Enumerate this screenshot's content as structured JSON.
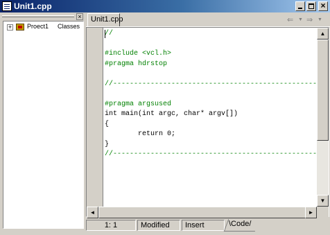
{
  "window": {
    "title": "Unit1.cpp",
    "controls": {
      "minimize": "_",
      "maximize": "□",
      "close": "×"
    }
  },
  "class_explorer": {
    "close_glyph": "×",
    "tree": [
      {
        "expander": "+",
        "label": "Proect1",
        "secondary": "Classes"
      }
    ]
  },
  "tabs": [
    {
      "label": "Unit1.cpp",
      "active": true
    }
  ],
  "navigation": {
    "back": "⇐",
    "forward": "⇒",
    "dropdown": "▼"
  },
  "editor": {
    "lines": [
      {
        "text": "//",
        "kind": "comment"
      },
      {
        "text": "",
        "kind": "blank"
      },
      {
        "text": "#include <vcl.h>",
        "kind": "directive"
      },
      {
        "text": "#pragma hdrstop",
        "kind": "directive"
      },
      {
        "text": "",
        "kind": "blank"
      },
      {
        "text": "//---------------------------------------------------------------------------",
        "kind": "comment"
      },
      {
        "text": "",
        "kind": "blank"
      },
      {
        "text": "#pragma argsused",
        "kind": "directive"
      },
      {
        "text": "int main(int argc, char* argv[])",
        "kind": "code"
      },
      {
        "text": "{",
        "kind": "code"
      },
      {
        "text": "        return 0;",
        "kind": "code"
      },
      {
        "text": "}",
        "kind": "code"
      },
      {
        "text": "//---------------------------------------------------------------------------",
        "kind": "comment"
      }
    ]
  },
  "scrollbars": {
    "up": "▲",
    "down": "▼",
    "left": "◄",
    "right": "►"
  },
  "status_bar": {
    "position": "1:  1",
    "modified": "Modified",
    "insert": "Insert",
    "code_tab": "\\Code/"
  },
  "colors": {
    "titlebar_start": "#0a246a",
    "titlebar_end": "#a6caf0",
    "comment": "#008000",
    "face": "#d4d0c8"
  }
}
